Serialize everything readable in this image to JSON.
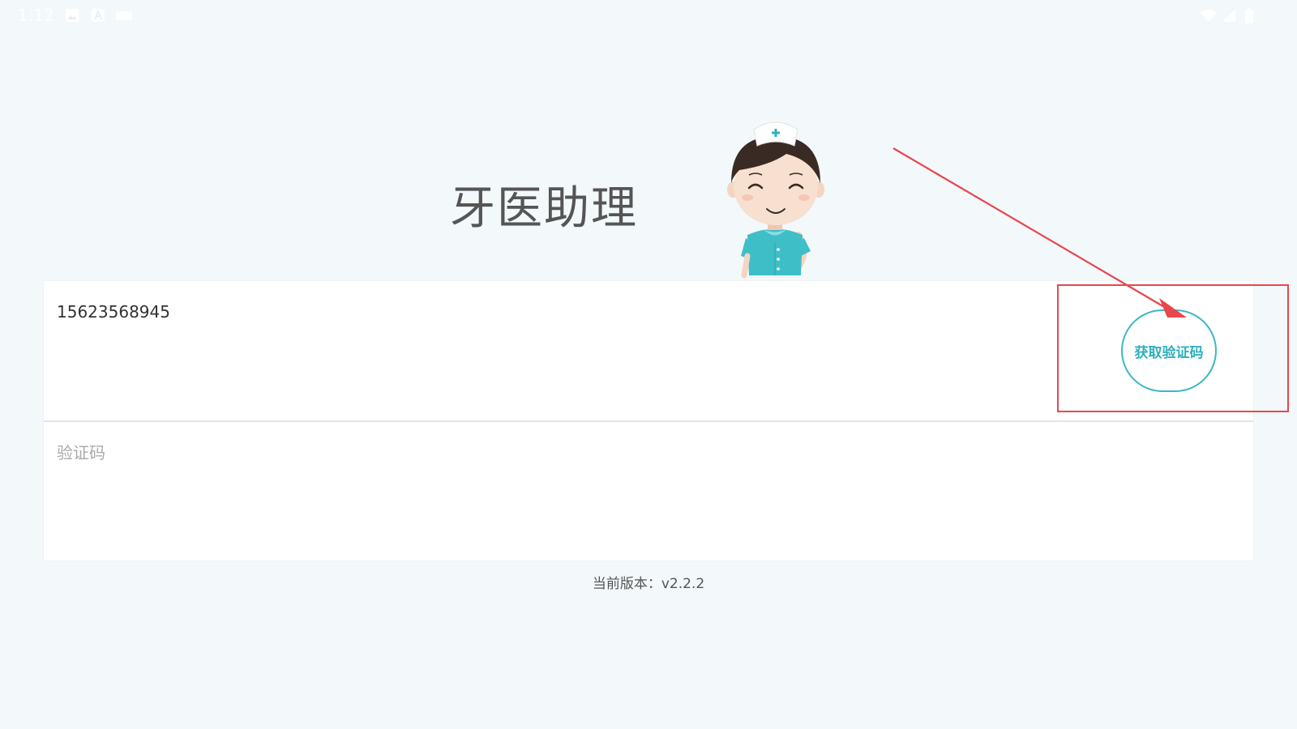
{
  "status_bar": {
    "time": "1:12",
    "left_icons": [
      "image-icon",
      "a-icon",
      "keyboard-icon"
    ],
    "right_icons": [
      "wifi-icon",
      "signal-icon",
      "battery-icon"
    ]
  },
  "app": {
    "title": "牙医助理",
    "mascot": "nurse-mascot"
  },
  "login_form": {
    "phone_value": "15623568945",
    "code_placeholder": "验证码",
    "get_code_label": "获取验证码"
  },
  "footer": {
    "version_text": "当前版本：v2.2.2"
  },
  "colors": {
    "background": "#f3f8fb",
    "accent": "#2fb0bd",
    "annotation": "#e8474c"
  }
}
